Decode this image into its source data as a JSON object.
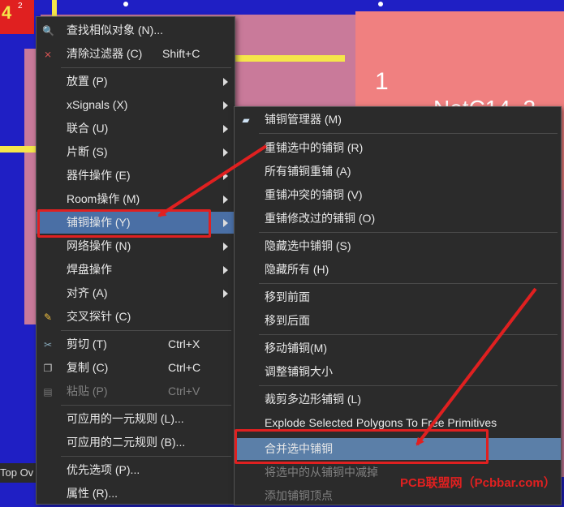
{
  "board": {
    "pad_label": "1",
    "net_label": "NetC14_2",
    "top_left_digit": "4",
    "tiny_label": "2",
    "layer_tab": "Top Ov"
  },
  "context_menu": {
    "items": [
      {
        "label": "查找相似对象 (N)...",
        "icon": "magnifier-icon"
      },
      {
        "label": "清除过滤器 (C)",
        "shortcut": "Shift+C",
        "icon": "clear-filter-icon"
      },
      {
        "label": "放置 (P)",
        "submenu": true
      },
      {
        "label": "xSignals (X)",
        "submenu": true
      },
      {
        "label": "联合 (U)",
        "submenu": true
      },
      {
        "label": "片断 (S)",
        "submenu": true
      },
      {
        "label": "器件操作 (E)",
        "submenu": true
      },
      {
        "label": "Room操作 (M)",
        "submenu": true
      },
      {
        "label": "铺铜操作 (Y)",
        "submenu": true,
        "highlighted": true
      },
      {
        "label": "网络操作 (N)",
        "submenu": true
      },
      {
        "label": "焊盘操作",
        "submenu": true
      },
      {
        "label": "对齐 (A)",
        "submenu": true
      },
      {
        "label": "交叉探针 (C)",
        "icon": "cross-probe-icon"
      },
      {
        "label": "剪切 (T)",
        "shortcut": "Ctrl+X",
        "icon": "scissors-icon"
      },
      {
        "label": "复制 (C)",
        "shortcut": "Ctrl+C",
        "icon": "copy-icon"
      },
      {
        "label": "粘贴 (P)",
        "shortcut": "Ctrl+V",
        "icon": "paste-icon",
        "disabled": true
      },
      {
        "label": "可应用的一元规则 (L)..."
      },
      {
        "label": "可应用的二元规则 (B)..."
      },
      {
        "label": "优先选项 (P)..."
      },
      {
        "label": "属性 (R)..."
      }
    ]
  },
  "polygon_submenu": {
    "items": [
      {
        "label": "铺铜管理器 (M)",
        "icon": "folder-icon"
      },
      {
        "label": "重铺选中的铺铜 (R)"
      },
      {
        "label": "所有铺铜重铺 (A)"
      },
      {
        "label": "重铺冲突的铺铜 (V)"
      },
      {
        "label": "重铺修改过的铺铜 (O)"
      },
      {
        "label": "隐藏选中铺铜 (S)"
      },
      {
        "label": "隐藏所有 (H)"
      },
      {
        "label": "移到前面"
      },
      {
        "label": "移到后面"
      },
      {
        "label": "移动铺铜(M)"
      },
      {
        "label": "调整铺铜大小"
      },
      {
        "label": "裁剪多边形铺铜 (L)"
      },
      {
        "label": "Explode Selected Polygons To Free Primitives"
      },
      {
        "label": "合并选中铺铜",
        "highlighted": true
      },
      {
        "label": "将选中的从铺铜中减掉",
        "disabled": true
      },
      {
        "label": "添加铺铜顶点",
        "disabled": true
      }
    ]
  },
  "watermark": "PCB联盟网（Pcbbar.com）",
  "colors": {
    "menu_bg": "#2b2b2b",
    "highlight": "#4a6fa5",
    "annotation_red": "#e02020",
    "board_blue": "#1f1fc4",
    "pad_salmon": "#f08080",
    "copper_pink": "#c97a9a"
  }
}
